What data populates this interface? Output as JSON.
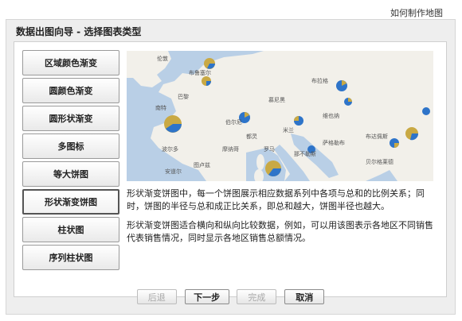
{
  "help_link": "如何制作地图",
  "dialog_title": "数据出图向导 - 选择图表类型",
  "chart_types": [
    {
      "label": "区域颜色渐变",
      "selected": false
    },
    {
      "label": "圆颜色渐变",
      "selected": false
    },
    {
      "label": "圆形状渐变",
      "selected": false
    },
    {
      "label": "多图标",
      "selected": false
    },
    {
      "label": "等大饼图",
      "selected": false
    },
    {
      "label": "形状渐变饼图",
      "selected": true
    },
    {
      "label": "柱状图",
      "selected": false
    },
    {
      "label": "序列柱状图",
      "selected": false
    }
  ],
  "map_labels": [
    "伦敦",
    "布鲁塞尔",
    "巴黎",
    "南特",
    "波尔多",
    "图卢兹",
    "布拉格",
    "维也纳",
    "慕尼黑",
    "伯尔尼",
    "米兰",
    "都灵",
    "摩纳哥",
    "罗马",
    "那不勒斯",
    "萨格勒布",
    "贝尔格莱德",
    "布达佩斯",
    "安道尔"
  ],
  "description": {
    "p1": "形状渐变饼图中，每一个饼图展示相应数据系列中各项与总和的比例关系；同时，饼图的半径与总和成正比关系，即总和越大，饼图半径也越大。",
    "p2": "形状渐变饼图适合横向和纵向比较数据，例如，可以用该图表示各地区不同销售代表销售情况，同时显示各地区销售总额情况。"
  },
  "buttons": {
    "back": "后退",
    "next": "下一步",
    "finish": "完成",
    "cancel": "取消"
  },
  "colors": {
    "land": "#f2f0ea",
    "sea": "#b9cfe6",
    "pie_gold": "#c9a944",
    "pie_blue": "#2e74c9"
  }
}
